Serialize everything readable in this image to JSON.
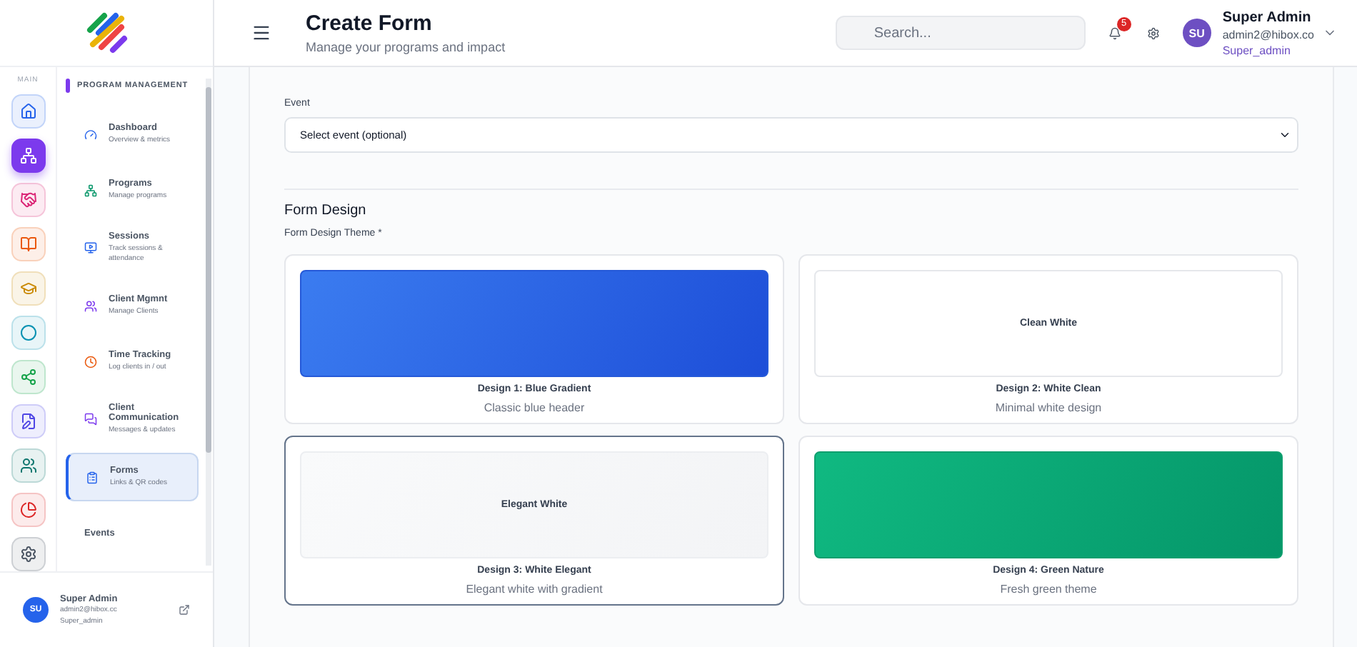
{
  "rail": {
    "label": "MAIN",
    "items": [
      {
        "color": "#2563eb",
        "selected": false
      },
      {
        "color": "#7c3aed",
        "selected": true
      },
      {
        "color": "#db2777",
        "selected": false
      },
      {
        "color": "#ea580c",
        "selected": false
      },
      {
        "color": "#ca8a04",
        "selected": false
      },
      {
        "color": "#0891b2",
        "selected": false
      },
      {
        "color": "#16a34a",
        "selected": false
      },
      {
        "color": "#4f46e5",
        "selected": false
      },
      {
        "color": "#0f766e",
        "selected": false
      },
      {
        "color": "#dc2626",
        "selected": false
      },
      {
        "color": "#4b5563",
        "selected": false
      }
    ]
  },
  "nav": {
    "title": "PROGRAM MANAGEMENT",
    "items": [
      {
        "title": "Dashboard",
        "subtitle": "Overview & metrics",
        "color": "#2563eb",
        "selected": false
      },
      {
        "title": "Programs",
        "subtitle": "Manage programs",
        "color": "#059669",
        "selected": false
      },
      {
        "title": "Sessions",
        "subtitle": "Track sessions & attendance",
        "color": "#2563eb",
        "selected": false
      },
      {
        "title": "Client Mgmnt",
        "subtitle": "Manage Clients",
        "color": "#7c3aed",
        "selected": false
      },
      {
        "title": "Time Tracking",
        "subtitle": "Log clients in / out",
        "color": "#ea580c",
        "selected": false
      },
      {
        "title": "Client Communication",
        "subtitle": "Messages & updates",
        "color": "#7c3aed",
        "selected": false
      },
      {
        "title": "Forms",
        "subtitle": "Links & QR codes",
        "color": "#2563eb",
        "selected": true
      },
      {
        "title": "Events",
        "selected": false
      }
    ]
  },
  "user_footer": {
    "initials": "SU",
    "name": "Super Admin",
    "email": "admin2@hibox.cc",
    "role": "Super_admin"
  },
  "header": {
    "title": "Create Form",
    "subtitle": "Manage your programs and impact",
    "search": {
      "placeholder": "Search..."
    },
    "notifications": "5",
    "user": {
      "initials": "SU",
      "name": "Super Admin",
      "email": "admin2@hibox.co",
      "role": "Super_admin"
    }
  },
  "form": {
    "event_label": "Event",
    "event_value": "Select event (optional)",
    "section_title": "Form Design",
    "theme_label": "Form Design Theme *",
    "designs": [
      {
        "kind": "blue-gradient",
        "title": "Design 1: Blue Gradient",
        "subtitle": "Classic blue header",
        "selected": false
      },
      {
        "kind": "white",
        "preview_text": "Clean White",
        "title": "Design 2: White Clean",
        "subtitle": "Minimal white design",
        "selected": false
      },
      {
        "kind": "elegant",
        "preview_text": "Elegant White",
        "title": "Design 3: White Elegant",
        "subtitle": "Elegant white with gradient",
        "selected": true
      },
      {
        "kind": "green-gradient",
        "title": "Design 4: Green Nature",
        "subtitle": "Fresh green theme",
        "selected": false
      }
    ]
  }
}
